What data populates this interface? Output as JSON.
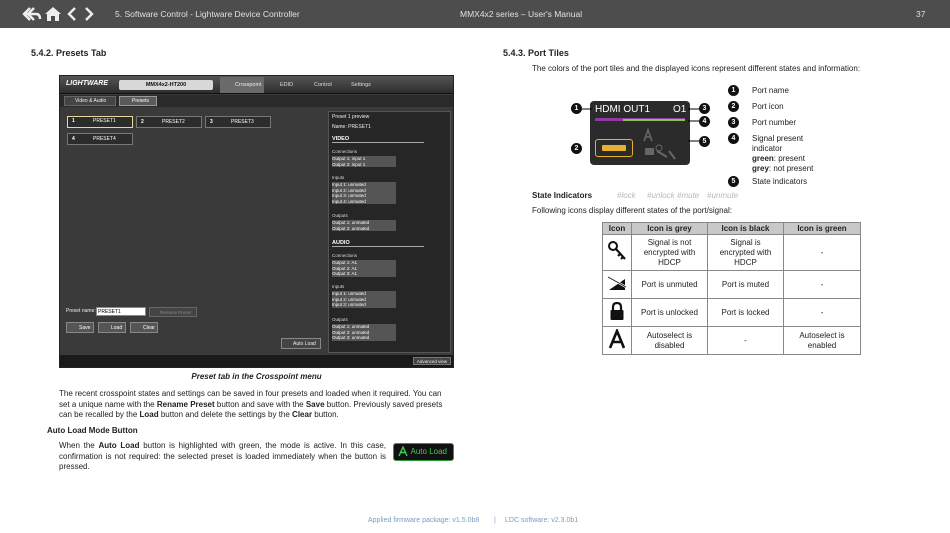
{
  "header": {
    "section": "5. Software Control - Lightware Device Controller",
    "doc_title": "MMX4x2 series – User's Manual",
    "page_number": "37"
  },
  "left": {
    "heading": "5.4.2. Presets Tab",
    "screenshot": {
      "brand": "LIGHTWARE",
      "device": "MMX4x2-HT200",
      "menu": [
        "Crosspoint",
        "EDID",
        "Control",
        "Settings"
      ],
      "tabs": [
        "Video & Audio",
        "Presets"
      ],
      "presets": [
        {
          "num": "1",
          "name": "PRESET1"
        },
        {
          "num": "2",
          "name": "PRESET2"
        },
        {
          "num": "3",
          "name": "PRESET3"
        },
        {
          "num": "4",
          "name": "PRESET4"
        }
      ],
      "preview_title": "Preset 1 preview",
      "preview_name": "Name: PRESET1",
      "video_label": "VIDEO",
      "connections_label": "Connections",
      "video_connections": [
        "Output 1: input 1",
        "Output 2: input 1"
      ],
      "inputs_label": "Inputs",
      "video_inputs": [
        "Input 1: unmuted",
        "Input 2: unmuted",
        "Input 3: unmuted",
        "Input 4: unmuted"
      ],
      "outputs_label": "Outputs",
      "video_outputs": [
        "Output 1: unmuted",
        "Output 2: unmuted"
      ],
      "audio_label": "AUDIO",
      "audio_connections": [
        "Output 1: A1",
        "Output 2: A1",
        "Output 3: A1"
      ],
      "audio_inputs": [
        "Input 1: unmuted",
        "Input 2: unmuted",
        "Input 3: unmuted"
      ],
      "audio_outputs": [
        "Output 1: unmuted",
        "Output 2: unmuted",
        "Output 3: unmuted"
      ],
      "preset_name_label": "Preset name:",
      "preset_name_value": "PRESET1",
      "rename_label": "Rename Preset",
      "save_label": "Save",
      "load_label": "Load",
      "clear_label": "Clear",
      "auto_load_label": "Auto Load",
      "advanced_view_label": "Advanced view"
    },
    "caption": "Preset tab in the Crosspoint menu",
    "para1_a": "The recent crosspoint states and settings can be saved in four presets and loaded when it required. You can set a unique name with the ",
    "para1_b": "Rename Preset",
    "para1_c": " button and save with the ",
    "para1_d": "Save",
    "para1_e": " button. Previously saved presets can be recalled by the ",
    "para1_f": "Load",
    "para1_g": " button and delete the settings by the ",
    "para1_h": "Clear",
    "para1_i": " button.",
    "subheading": "Auto Load Mode Button",
    "para2_a": "When the ",
    "para2_b": "Auto Load",
    "para2_c": " button is highlighted with green, the mode is active. In this case, confirmation is not required: the selected preset is loaded immediately when the button is pressed.",
    "auto_load_button": "Auto Load"
  },
  "right": {
    "heading": "5.4.3. Port Tiles",
    "intro": "The colors of the port tiles and the displayed icons represent different states and information:",
    "tile": {
      "port_name": "HDMI OUT1",
      "port_number": "O1"
    },
    "legend": [
      {
        "n": "1",
        "text": "Port name"
      },
      {
        "n": "2",
        "text": "Port icon"
      },
      {
        "n": "3",
        "text": "Port number"
      },
      {
        "n": "4",
        "text": "Signal present indicator"
      },
      {
        "n": "5",
        "text": "State indicators"
      }
    ],
    "green_label": "green",
    "green_text": ": present",
    "grey_label": "grey",
    "grey_text": ": not present",
    "state_indicators_label": "State Indicators",
    "state_tags": [
      "#lock",
      "#unlock",
      "#mute",
      "#unmute"
    ],
    "following": "Following icons display different states of the port/signal:",
    "table": {
      "headers": [
        "Icon",
        "Icon is grey",
        "Icon is black",
        "Icon is green"
      ],
      "rows": [
        {
          "icon": "key-icon",
          "grey": "Signal is not encrypted with HDCP",
          "black": "Signal is encrypted with HDCP",
          "green": "-"
        },
        {
          "icon": "mute-icon",
          "grey": "Port is unmuted",
          "black": "Port is muted",
          "green": "-"
        },
        {
          "icon": "lock-icon",
          "grey": "Port is unlocked",
          "black": "Port is locked",
          "green": "-"
        },
        {
          "icon": "autoselect-icon",
          "grey": "Autoselect is disabled",
          "black": "-",
          "green": "Autoselect is enabled"
        }
      ]
    }
  },
  "footer": {
    "firmware": "Applied firmware package: v1.5.0b8",
    "separator": "|",
    "software": "LDC software: v2.3.0b1"
  }
}
